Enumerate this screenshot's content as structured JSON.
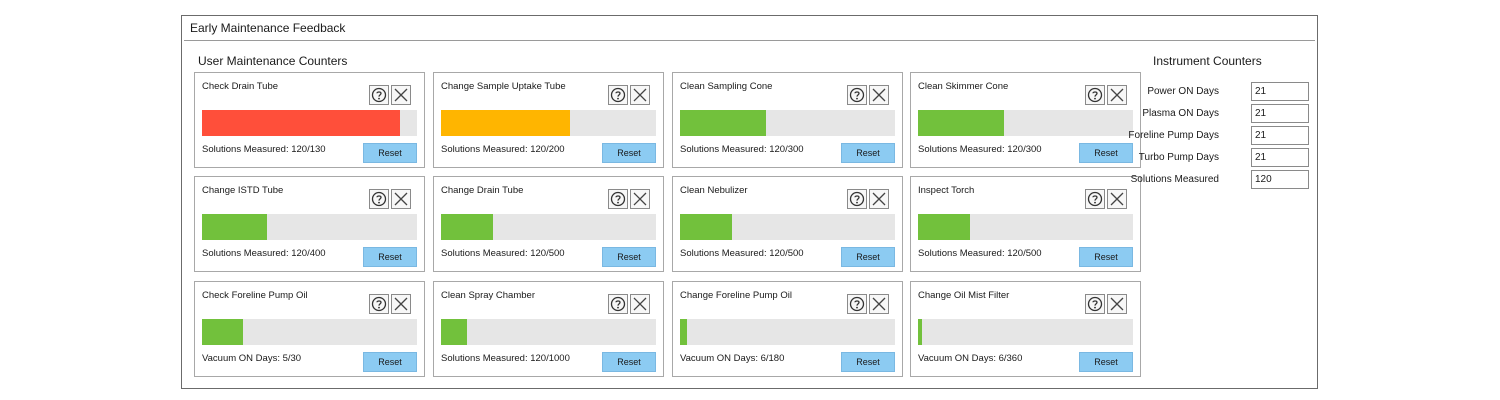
{
  "window": {
    "title": "Early Maintenance Feedback"
  },
  "user_section": {
    "title": "User Maintenance Counters",
    "reset_label": "Reset"
  },
  "cards": [
    {
      "title": "Check Drain Tube",
      "status": "Solutions Measured: 120/130",
      "progress": 0.923,
      "color": "#ff4f3a"
    },
    {
      "title": "Change Sample Uptake Tube",
      "status": "Solutions Measured: 120/200",
      "progress": 0.6,
      "color": "#ffb500"
    },
    {
      "title": "Clean Sampling Cone",
      "status": "Solutions Measured: 120/300",
      "progress": 0.4,
      "color": "#72c13c"
    },
    {
      "title": "Clean Skimmer Cone",
      "status": "Solutions Measured: 120/300",
      "progress": 0.4,
      "color": "#72c13c"
    },
    {
      "title": "Change ISTD Tube",
      "status": "Solutions Measured: 120/400",
      "progress": 0.3,
      "color": "#72c13c"
    },
    {
      "title": "Change Drain Tube",
      "status": "Solutions Measured: 120/500",
      "progress": 0.24,
      "color": "#72c13c"
    },
    {
      "title": "Clean Nebulizer",
      "status": "Solutions Measured: 120/500",
      "progress": 0.24,
      "color": "#72c13c"
    },
    {
      "title": "Inspect Torch",
      "status": "Solutions Measured: 120/500",
      "progress": 0.24,
      "color": "#72c13c"
    },
    {
      "title": "Check Foreline Pump Oil",
      "status": "Vacuum ON Days: 5/30",
      "progress": 0.19,
      "color": "#72c13c"
    },
    {
      "title": "Clean Spray Chamber",
      "status": "Solutions Measured: 120/1000",
      "progress": 0.12,
      "color": "#72c13c"
    },
    {
      "title": "Change Foreline Pump Oil",
      "status": "Vacuum ON Days: 6/180",
      "progress": 0.034,
      "color": "#72c13c"
    },
    {
      "title": "Change Oil Mist Filter",
      "status": "Vacuum ON Days: 6/360",
      "progress": 0.017,
      "color": "#72c13c"
    }
  ],
  "instrument_section": {
    "title": "Instrument Counters",
    "counters": [
      {
        "label": "Power ON Days",
        "value": "21"
      },
      {
        "label": "Plasma ON Days",
        "value": "21"
      },
      {
        "label": "Foreline Pump Days",
        "value": "21"
      },
      {
        "label": "Turbo Pump Days",
        "value": "21"
      },
      {
        "label": "Solutions Measured",
        "value": "120"
      }
    ]
  },
  "icons": {
    "help": "help-circle-icon",
    "close": "close-x-icon"
  }
}
